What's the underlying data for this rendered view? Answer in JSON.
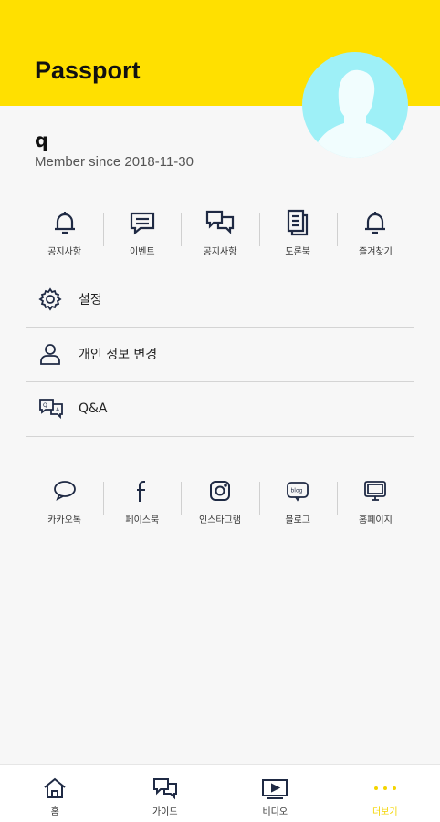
{
  "header": {
    "title": "Passport"
  },
  "profile": {
    "name": "q",
    "member_since": "Member since 2018-11-30",
    "avatar_color": "#9ef0f7"
  },
  "top_icons": [
    {
      "label": "공지사항",
      "icon": "bell-icon"
    },
    {
      "label": "이벤트",
      "icon": "chat-bubble-icon"
    },
    {
      "label": "공지사항",
      "icon": "double-chat-icon"
    },
    {
      "label": "도론북",
      "icon": "document-icon"
    },
    {
      "label": "즐겨찾기",
      "icon": "bell-icon"
    }
  ],
  "menu": [
    {
      "label": "설정",
      "icon": "gear-icon"
    },
    {
      "label": "개인 정보 변경",
      "icon": "person-icon"
    },
    {
      "label": "Q&A",
      "icon": "qa-icon"
    }
  ],
  "social": [
    {
      "label": "카카오톡",
      "icon": "kakaotalk-icon"
    },
    {
      "label": "페이스북",
      "icon": "facebook-icon"
    },
    {
      "label": "인스타그램",
      "icon": "instagram-icon"
    },
    {
      "label": "블로그",
      "icon": "blog-icon"
    },
    {
      "label": "홈페이지",
      "icon": "monitor-icon"
    }
  ],
  "tabs": [
    {
      "label": "홈",
      "icon": "home-icon"
    },
    {
      "label": "가이드",
      "icon": "guide-icon"
    },
    {
      "label": "비디오",
      "icon": "video-icon"
    },
    {
      "label": "더보기",
      "icon": "more-icon",
      "active": true
    }
  ],
  "colors": {
    "accent": "#ffe000",
    "active_tab": "#f3d400"
  }
}
